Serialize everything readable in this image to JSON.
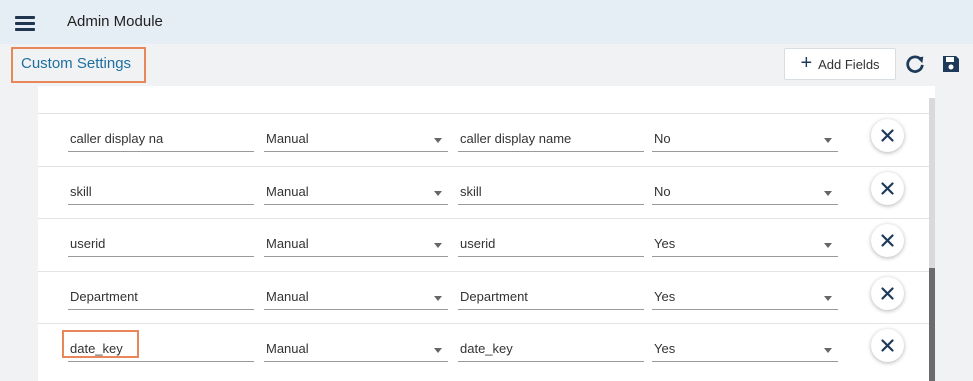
{
  "header": {
    "app_title": "Admin Module"
  },
  "toolbar": {
    "page_title": "Custom Settings",
    "add_fields_label": "Add Fields",
    "add_icon": "plus-icon",
    "refresh_icon": "refresh-icon",
    "save_icon": "save-icon"
  },
  "rows": [
    {
      "field": "caller display na",
      "type": "Manual",
      "display": "caller display name",
      "flag": "No"
    },
    {
      "field": "skill",
      "type": "Manual",
      "display": "skill",
      "flag": "No"
    },
    {
      "field": "userid",
      "type": "Manual",
      "display": "userid",
      "flag": "Yes"
    },
    {
      "field": "Department",
      "type": "Manual",
      "display": "Department",
      "flag": "Yes"
    },
    {
      "field": "date_key",
      "type": "Manual",
      "display": "date_key",
      "flag": "Yes"
    }
  ],
  "colors": {
    "accent": "#1e6f9f",
    "highlight": "#e8875a",
    "header_bg": "#e6eef5",
    "icon": "#1e3a5a"
  }
}
